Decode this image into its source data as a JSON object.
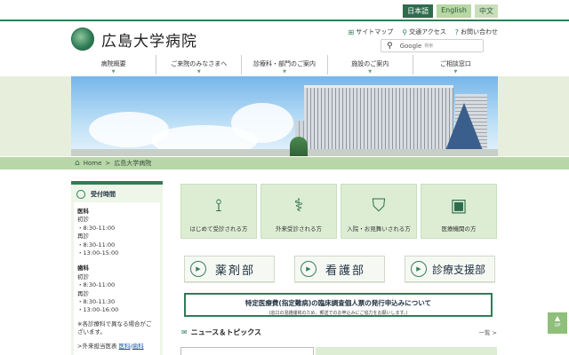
{
  "lang": {
    "ja": "日本語",
    "en": "English",
    "zh": "中文"
  },
  "logo": {
    "text": "広島大学病院"
  },
  "util": [
    {
      "icon": "sitemap-icon",
      "label": "サイトマップ"
    },
    {
      "icon": "location-pin-icon",
      "label": "交通アクセス"
    },
    {
      "icon": "question-icon",
      "label": "お問い合わせ"
    }
  ],
  "search": {
    "brand": "Google",
    "placeholder": "検索"
  },
  "nav": [
    "病院概要",
    "ご来院のみなさまへ",
    "診療科・部門のご案内",
    "施設のご案内",
    "ご相談窓口"
  ],
  "breadcrumb": {
    "home": "Home",
    "sep": ">",
    "current": "広島大学病院"
  },
  "sidebar": {
    "title": "受付時間",
    "lines": [
      {
        "t": "医科",
        "cls": "cat"
      },
      {
        "t": "初診",
        "cls": ""
      },
      {
        "t": "・8:30-11:00",
        "cls": ""
      },
      {
        "t": "再診",
        "cls": ""
      },
      {
        "t": "・8:30-11:00",
        "cls": ""
      },
      {
        "t": "・13:00-15:00",
        "cls": ""
      },
      {
        "t": "",
        "cls": ""
      },
      {
        "t": "歯科",
        "cls": "cat"
      },
      {
        "t": "初診",
        "cls": ""
      },
      {
        "t": "・8:30-11:00",
        "cls": ""
      },
      {
        "t": "再診",
        "cls": ""
      },
      {
        "t": "・8:30-11:30",
        "cls": ""
      },
      {
        "t": "・13:00-16:00",
        "cls": ""
      },
      {
        "t": "",
        "cls": ""
      },
      {
        "t": "※各診療科で異なる場合がございます。",
        "cls": ""
      },
      {
        "t": "",
        "cls": ""
      }
    ],
    "outpatient_prefix": ">外来担当医表 ",
    "outpatient_link1": "医科",
    "outpatient_sep": "/",
    "outpatient_link2": "歯科"
  },
  "cards": [
    {
      "icon": "beginner-mark-icon",
      "glyph": "⟟",
      "label": "はじめて受診される方"
    },
    {
      "icon": "stethoscope-icon",
      "glyph": "⚕",
      "label": "外来受診される方"
    },
    {
      "icon": "hospital-bed-icon",
      "glyph": "⛉",
      "label": "入院・お見舞いされる方"
    },
    {
      "icon": "clipboard-icon",
      "glyph": "▣",
      "label": "医療機関の方"
    }
  ],
  "depts": [
    {
      "label": "薬剤部"
    },
    {
      "label": "看護部"
    },
    {
      "label": "診療支援部"
    }
  ],
  "notice": {
    "title": "特定医療費(指定難病)の臨床調査個人票の発行申込みについて",
    "sub": "(窓口の混雑緩和のため、郵送でのお申込みにご協力をお願いします。)"
  },
  "news": {
    "title": "ニュース＆トピックス",
    "more": "一覧 >"
  },
  "up": {
    "label": "UP"
  }
}
